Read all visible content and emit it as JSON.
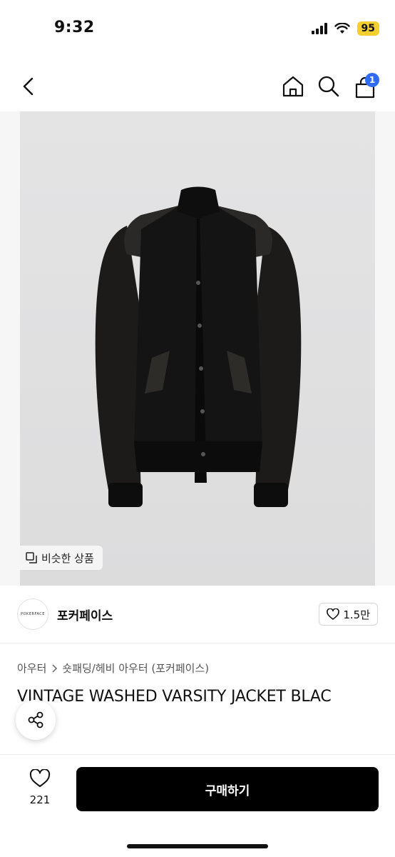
{
  "status_bar": {
    "time": "9:32",
    "battery": "95",
    "icons": [
      "signal-icon",
      "wifi-icon"
    ]
  },
  "header": {
    "cart_count": "1",
    "icons": [
      "back-icon",
      "home-icon",
      "search-icon",
      "cart-icon"
    ]
  },
  "product_image": {
    "similar_label": "비슷한 상품"
  },
  "brand": {
    "logo_text": "POKERFACE",
    "name": "포커페이스",
    "likes": "1.5만"
  },
  "breadcrumb": {
    "level1": "아우터",
    "level2": "숏패딩/헤비 아우터 (포커페이스)"
  },
  "product": {
    "title": "VINTAGE WASHED VARSITY JACKET BLAC"
  },
  "bottom_bar": {
    "wish_count": "221",
    "buy_label": "구매하기"
  },
  "colors": {
    "accent_badge": "#2f6bf5",
    "battery": "#f3cf2f",
    "buy_button": "#000000"
  }
}
